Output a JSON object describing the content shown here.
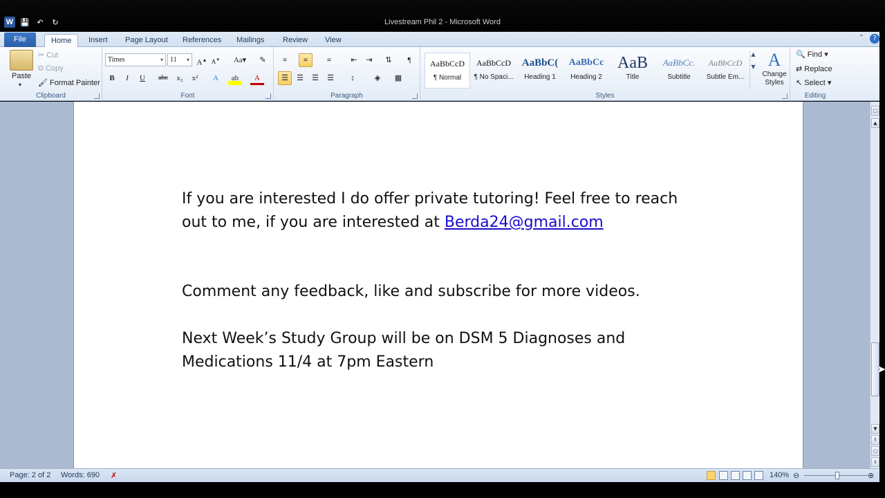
{
  "window": {
    "title": "Livestream Phil 2  -  Microsoft Word"
  },
  "tabs": [
    "File",
    "Home",
    "Insert",
    "Page Layout",
    "References",
    "Mailings",
    "Review",
    "View"
  ],
  "clipboard": {
    "paste": "Paste",
    "cut": "Cut",
    "copy": "Copy",
    "format_painter": "Format Painter",
    "label": "Clipboard"
  },
  "font": {
    "name": "Times",
    "size": "11",
    "label": "Font",
    "bold": "B",
    "italic": "I",
    "underline": "U",
    "strike": "abc",
    "subscript": "x₂",
    "superscript": "x²",
    "change_case": "Aa"
  },
  "paragraph": {
    "label": "Paragraph",
    "pilcrow": "¶"
  },
  "styles": {
    "label": "Styles",
    "items": [
      {
        "sample": "AaBbCcD",
        "name": "¶ Normal"
      },
      {
        "sample": "AaBbCcD",
        "name": "¶ No Spaci..."
      },
      {
        "sample": "AaBbC(",
        "name": "Heading 1"
      },
      {
        "sample": "AaBbCc",
        "name": "Heading 2"
      },
      {
        "sample": "AaB",
        "name": "Title"
      },
      {
        "sample": "AaBbCc.",
        "name": "Subtitle"
      },
      {
        "sample": "AaBbCcD",
        "name": "Subtle Em..."
      }
    ],
    "change_styles": "Change Styles"
  },
  "editing": {
    "label": "Editing",
    "find": "Find",
    "replace": "Replace",
    "select": "Select"
  },
  "document": {
    "p1_text": "If you are interested I do offer private tutoring! Feel free to reach out to me, if you are interested at ",
    "p1_link": "Berda24@gmail.com",
    "p2": "Comment any feedback, like and subscribe for more videos.",
    "p3": "Next Week’s Study Group will be on DSM 5 Diagnoses and Medications 11/4 at 7pm Eastern"
  },
  "status": {
    "page": "Page: 2 of 2",
    "words": "Words: 690",
    "zoom": "140%"
  },
  "colors": {
    "ribbon_bg": "#e3ecf7",
    "doc_bg": "#abbad0",
    "link": "#1a0dcc",
    "file_tab": "#2a5ea8"
  },
  "icons": [
    "word-icon",
    "save-icon",
    "undo-icon",
    "redo-icon",
    "paste-icon",
    "find-icon",
    "help-icon",
    "zoom-out-icon",
    "zoom-in-icon"
  ]
}
